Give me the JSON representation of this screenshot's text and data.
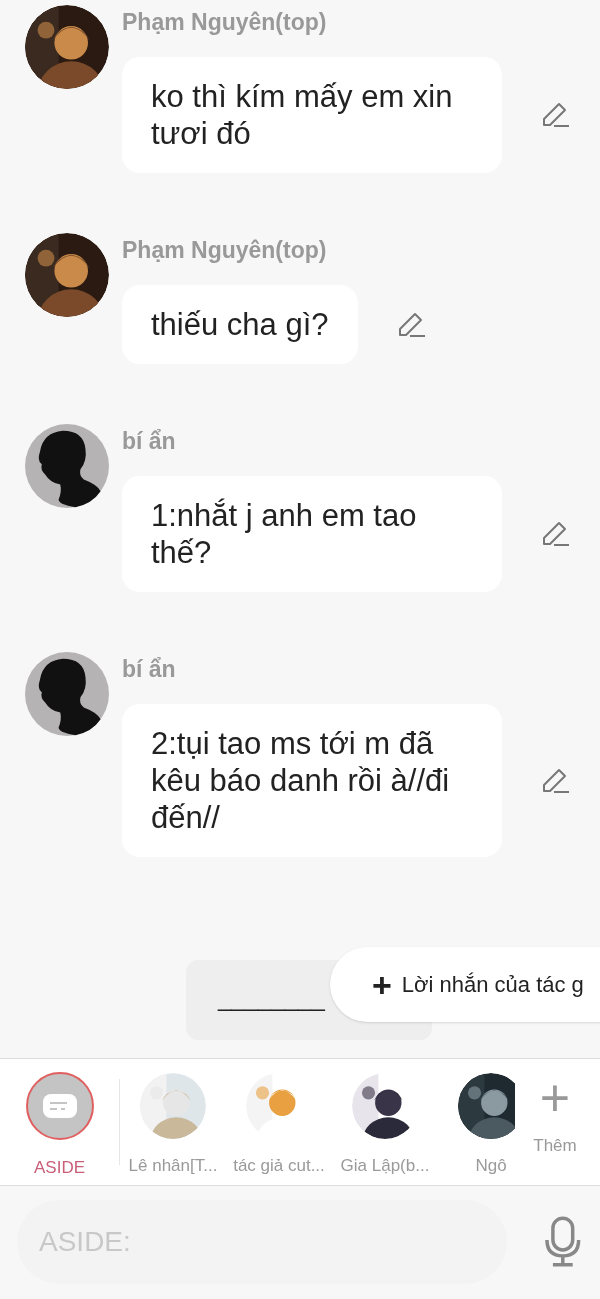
{
  "messages": [
    {
      "sender": "Phạm Nguyên(top)",
      "text": "ko thì kím mấy em xin tươi đó"
    },
    {
      "sender": "Phạm Nguyên(top)",
      "text": "thiếu cha gì?"
    },
    {
      "sender": "bí ẩn",
      "avatar": {
        "kind": "silhouette"
      },
      "text": "1:nhắt j anh em tao thế?"
    },
    {
      "sender": "bí ẩn",
      "avatar": {
        "kind": "silhouette"
      },
      "text": "2:tụi tao ms tới m đã kêu báo danh rồi à//đi đến//"
    }
  ],
  "divider_card": {
    "text": "________"
  },
  "author_note_button": {
    "icon": "+",
    "label": "Lời nhắn của tác g"
  },
  "characters": [
    {
      "label": "ASIDE",
      "selected": true,
      "kind": "aside"
    },
    {
      "label": "Lê nhân[T...",
      "selected": false,
      "kind": "picture"
    },
    {
      "label": "tác giả cut...",
      "selected": false,
      "kind": "picture"
    },
    {
      "label": "Gia Lập(b...",
      "selected": false,
      "kind": "picture"
    },
    {
      "label": "Ngô",
      "selected": false,
      "kind": "picture"
    }
  ],
  "add_character": {
    "icon": "+",
    "label": "Thêm"
  },
  "input": {
    "placeholder": "ASIDE:"
  }
}
